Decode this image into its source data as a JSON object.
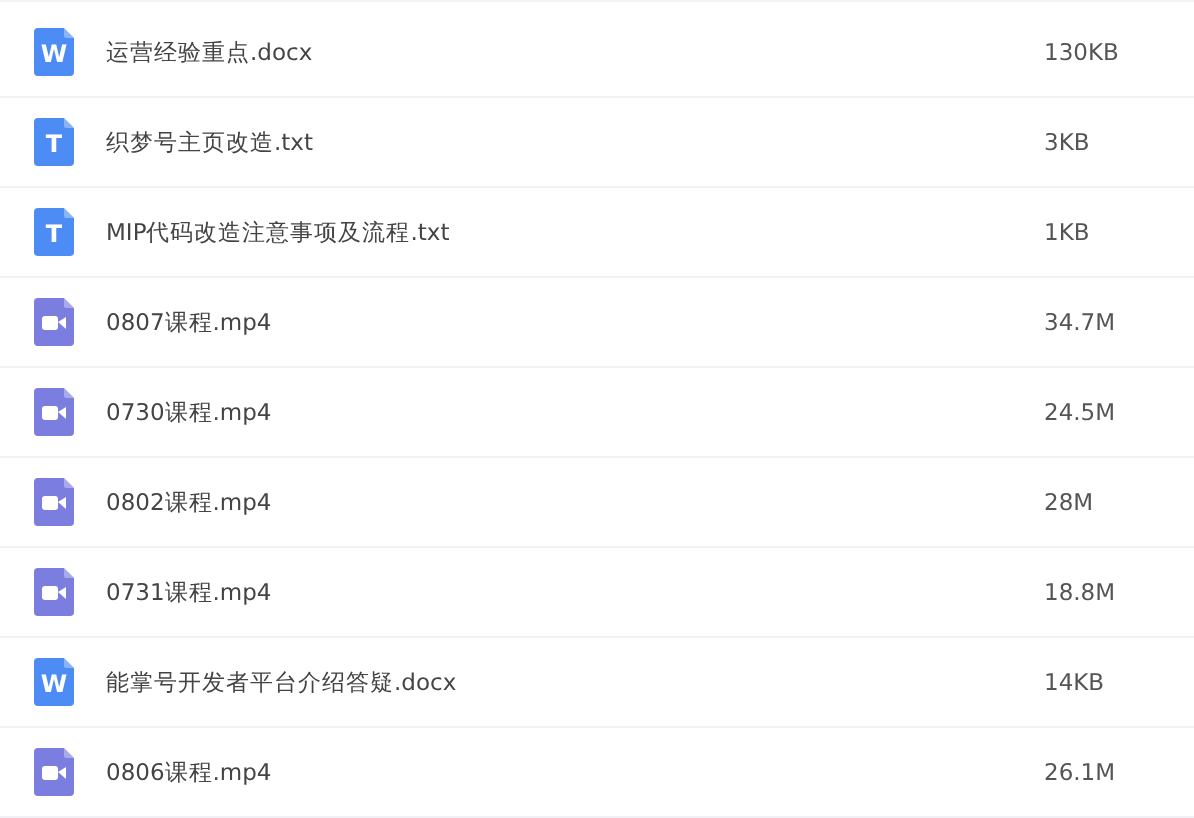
{
  "files": [
    {
      "kind": "word",
      "icon_letter": "W",
      "name": "运营经验重点.docx",
      "size": "130KB"
    },
    {
      "kind": "text",
      "icon_letter": "T",
      "name": "织梦号主页改造.txt",
      "size": "3KB"
    },
    {
      "kind": "text",
      "icon_letter": "T",
      "name": "MIP代码改造注意事项及流程.txt",
      "size": "1KB"
    },
    {
      "kind": "video",
      "name": "0807课程.mp4",
      "size": "34.7M"
    },
    {
      "kind": "video",
      "name": "0730课程.mp4",
      "size": "24.5M"
    },
    {
      "kind": "video",
      "name": "0802课程.mp4",
      "size": "28M"
    },
    {
      "kind": "video",
      "name": "0731课程.mp4",
      "size": "18.8M"
    },
    {
      "kind": "word",
      "icon_letter": "W",
      "name": "能掌号开发者平台介绍答疑.docx",
      "size": "14KB"
    },
    {
      "kind": "video",
      "name": "0806课程.mp4",
      "size": "26.1M"
    }
  ]
}
